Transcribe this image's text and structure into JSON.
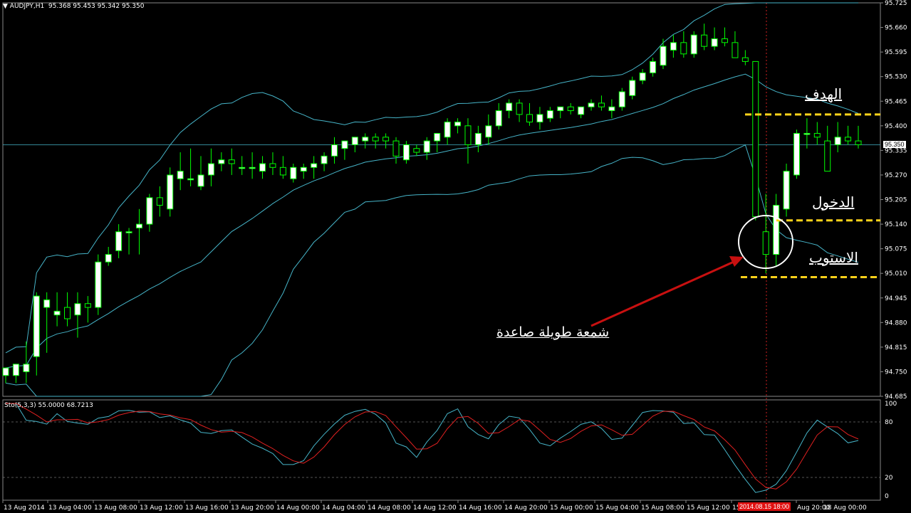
{
  "symbol_info": "AUDJPY,H1  95.368 95.453 95.342 95.350",
  "indicator_info": "Sto(5,3,3) 55.0000 68.7213",
  "colors": {
    "bull": "#ffffff",
    "bear": "#000000",
    "wick": "#00ff00",
    "bands": "#46b4c8",
    "signal": "#e02020",
    "target": "#ffd21a",
    "arrow": "#c81010"
  },
  "icons": {
    "menu": "triangle-down-icon"
  },
  "price_axis": {
    "labels": [
      "95.725",
      "95.660",
      "95.595",
      "95.530",
      "95.465",
      "95.400",
      "95.335",
      "95.270",
      "95.205",
      "95.140",
      "95.075",
      "95.010",
      "94.945",
      "94.880",
      "94.815",
      "94.750",
      "94.685"
    ],
    "current": "95.350"
  },
  "stoch_axis": {
    "labels": [
      "100",
      "80",
      "20",
      "0"
    ]
  },
  "time_axis": {
    "labels": [
      "13 Aug 2014",
      "13 Aug 04:00",
      "13 Aug 08:00",
      "13 Aug 12:00",
      "13 Aug 16:00",
      "13 Aug 20:00",
      "14 Aug 00:00",
      "14 Aug 04:00",
      "14 Aug 08:00",
      "14 Aug 12:00",
      "14 Aug 16:00",
      "14 Aug 20:00",
      "15 Aug 00:00",
      "15 Aug 04:00",
      "15 Aug 08:00",
      "15 Aug 12:00",
      "15",
      "Aug 20:00",
      "18 Aug 00:00"
    ],
    "cursor": "2014.08.15 18:00"
  },
  "annotations": {
    "target": "الهدف",
    "entry": "الدخول",
    "stop": "الاستوب",
    "candle": "شمعة طويلة صاعدة"
  },
  "levels": {
    "target": 95.43,
    "entry": 95.15,
    "stop": 95.0
  },
  "candles": [
    [
      94.74,
      94.76,
      94.72,
      94.76
    ],
    [
      94.74,
      94.77,
      94.72,
      94.77
    ],
    [
      94.75,
      94.83,
      94.72,
      94.77
    ],
    [
      94.79,
      94.96,
      94.74,
      94.95
    ],
    [
      94.92,
      94.96,
      94.8,
      94.94
    ],
    [
      94.9,
      94.96,
      94.87,
      94.91
    ],
    [
      94.92,
      94.96,
      94.87,
      94.89
    ],
    [
      94.9,
      94.96,
      94.84,
      94.93
    ],
    [
      94.93,
      94.95,
      94.88,
      94.92
    ],
    [
      94.92,
      95.06,
      94.9,
      95.04
    ],
    [
      95.04,
      95.08,
      95.03,
      95.06
    ],
    [
      95.07,
      95.14,
      95.05,
      95.12
    ],
    [
      95.12,
      95.13,
      95.06,
      95.12
    ],
    [
      95.13,
      95.18,
      95.06,
      95.14
    ],
    [
      95.14,
      95.22,
      95.12,
      95.21
    ],
    [
      95.21,
      95.24,
      95.16,
      95.19
    ],
    [
      95.18,
      95.29,
      95.16,
      95.27
    ],
    [
      95.26,
      95.33,
      95.23,
      95.28
    ],
    [
      95.26,
      95.34,
      95.24,
      95.26
    ],
    [
      95.24,
      95.32,
      95.23,
      95.27
    ],
    [
      95.27,
      95.34,
      95.24,
      95.3
    ],
    [
      95.3,
      95.33,
      95.28,
      95.31
    ],
    [
      95.31,
      95.34,
      95.27,
      95.3
    ],
    [
      95.29,
      95.32,
      95.27,
      95.29
    ],
    [
      95.29,
      95.33,
      95.26,
      95.29
    ],
    [
      95.28,
      95.32,
      95.26,
      95.3
    ],
    [
      95.3,
      95.33,
      95.27,
      95.29
    ],
    [
      95.29,
      95.32,
      95.26,
      95.27
    ],
    [
      95.26,
      95.3,
      95.25,
      95.29
    ],
    [
      95.28,
      95.3,
      95.26,
      95.29
    ],
    [
      95.29,
      95.32,
      95.26,
      95.3
    ],
    [
      95.3,
      95.33,
      95.28,
      95.32
    ],
    [
      95.32,
      95.37,
      95.3,
      95.35
    ],
    [
      95.34,
      95.36,
      95.31,
      95.36
    ],
    [
      95.35,
      95.37,
      95.33,
      95.37
    ],
    [
      95.36,
      95.38,
      95.34,
      95.37
    ],
    [
      95.37,
      95.38,
      95.34,
      95.36
    ],
    [
      95.37,
      95.38,
      95.34,
      95.36
    ],
    [
      95.36,
      95.37,
      95.3,
      95.32
    ],
    [
      95.31,
      95.36,
      95.3,
      95.35
    ],
    [
      95.34,
      95.35,
      95.32,
      95.33
    ],
    [
      95.33,
      95.37,
      95.31,
      95.36
    ],
    [
      95.36,
      95.38,
      95.33,
      95.38
    ],
    [
      95.37,
      95.42,
      95.35,
      95.41
    ],
    [
      95.4,
      95.42,
      95.38,
      95.41
    ],
    [
      95.4,
      95.42,
      95.3,
      95.35
    ],
    [
      95.35,
      95.4,
      95.33,
      95.38
    ],
    [
      95.37,
      95.43,
      95.35,
      95.4
    ],
    [
      95.4,
      95.46,
      95.39,
      95.44
    ],
    [
      95.44,
      95.47,
      95.42,
      95.46
    ],
    [
      95.46,
      95.47,
      95.41,
      95.43
    ],
    [
      95.43,
      95.46,
      95.4,
      95.41
    ],
    [
      95.41,
      95.45,
      95.39,
      95.43
    ],
    [
      95.42,
      95.45,
      95.41,
      95.44
    ],
    [
      95.44,
      95.45,
      95.42,
      95.45
    ],
    [
      95.45,
      95.46,
      95.43,
      95.44
    ],
    [
      95.43,
      95.45,
      95.42,
      95.45
    ],
    [
      95.45,
      95.47,
      95.44,
      95.46
    ],
    [
      95.46,
      95.48,
      95.44,
      95.45
    ],
    [
      95.44,
      95.47,
      95.42,
      95.45
    ],
    [
      95.45,
      95.5,
      95.44,
      95.49
    ],
    [
      95.48,
      95.53,
      95.47,
      95.52
    ],
    [
      95.52,
      95.55,
      95.51,
      95.54
    ],
    [
      95.54,
      95.58,
      95.53,
      95.57
    ],
    [
      95.56,
      95.63,
      95.55,
      95.61
    ],
    [
      95.6,
      95.64,
      95.58,
      95.62
    ],
    [
      95.62,
      95.65,
      95.58,
      95.59
    ],
    [
      95.59,
      95.65,
      95.58,
      95.64
    ],
    [
      95.64,
      95.67,
      95.6,
      95.61
    ],
    [
      95.61,
      95.66,
      95.6,
      95.63
    ],
    [
      95.63,
      95.66,
      95.61,
      95.62
    ],
    [
      95.62,
      95.65,
      95.58,
      95.58
    ],
    [
      95.58,
      95.6,
      95.56,
      95.57
    ],
    [
      95.57,
      95.55,
      95.15,
      95.16
    ],
    [
      95.12,
      95.22,
      95.01,
      95.06
    ],
    [
      95.06,
      95.22,
      95.03,
      95.19
    ],
    [
      95.18,
      95.3,
      95.16,
      95.28
    ],
    [
      95.27,
      95.39,
      95.26,
      95.38
    ],
    [
      95.38,
      95.42,
      95.34,
      95.38
    ],
    [
      95.38,
      95.41,
      95.35,
      95.37
    ],
    [
      95.36,
      95.4,
      95.28,
      95.28
    ],
    [
      95.35,
      95.41,
      95.33,
      95.37
    ],
    [
      95.37,
      95.4,
      95.35,
      95.36
    ],
    [
      95.36,
      95.4,
      95.34,
      95.35
    ]
  ]
}
